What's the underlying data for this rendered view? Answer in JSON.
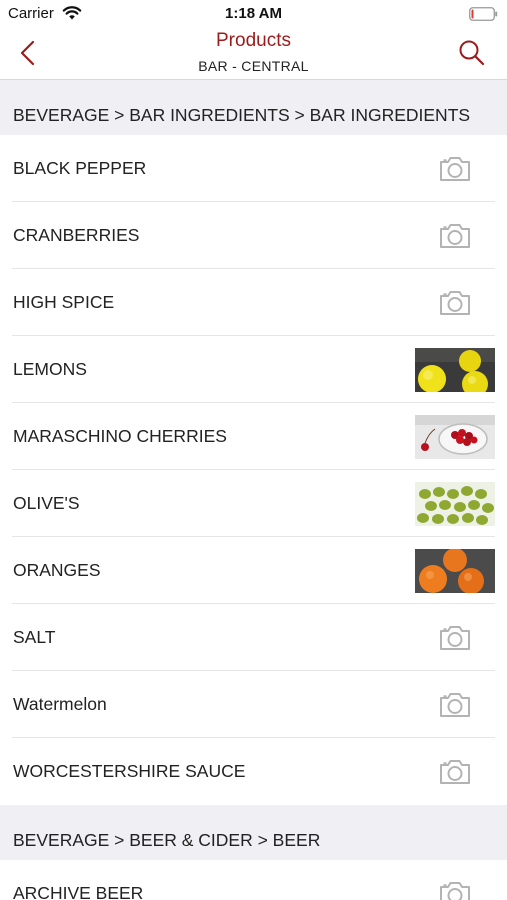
{
  "status_bar": {
    "carrier": "Carrier",
    "time": "1:18 AM"
  },
  "nav": {
    "title": "Products",
    "subtitle": "BAR - CENTRAL"
  },
  "colors": {
    "accent": "#9b1c1c",
    "section_bg": "#efeff4",
    "icon_gray": "#b3b3b3"
  },
  "sections": [
    {
      "header": "BEVERAGE > BAR INGREDIENTS > BAR INGREDIENTS",
      "items": [
        {
          "label": "BLACK PEPPER",
          "image": "camera-placeholder-icon"
        },
        {
          "label": "CRANBERRIES",
          "image": "camera-placeholder-icon"
        },
        {
          "label": "HIGH SPICE",
          "image": "camera-placeholder-icon"
        },
        {
          "label": "LEMONS",
          "image": "lemons-photo"
        },
        {
          "label": "MARASCHINO CHERRIES",
          "image": "maraschino-cherries-photo"
        },
        {
          "label": "OLIVE'S",
          "image": "olives-photo"
        },
        {
          "label": "ORANGES",
          "image": "oranges-photo"
        },
        {
          "label": "SALT",
          "image": "camera-placeholder-icon"
        },
        {
          "label": "Watermelon",
          "image": "camera-placeholder-icon"
        },
        {
          "label": "WORCESTERSHIRE SAUCE",
          "image": "camera-placeholder-icon"
        }
      ]
    },
    {
      "header": "BEVERAGE > BEER & CIDER > BEER",
      "items": [
        {
          "label": "ARCHIVE BEER",
          "image": "camera-placeholder-icon"
        }
      ]
    }
  ]
}
